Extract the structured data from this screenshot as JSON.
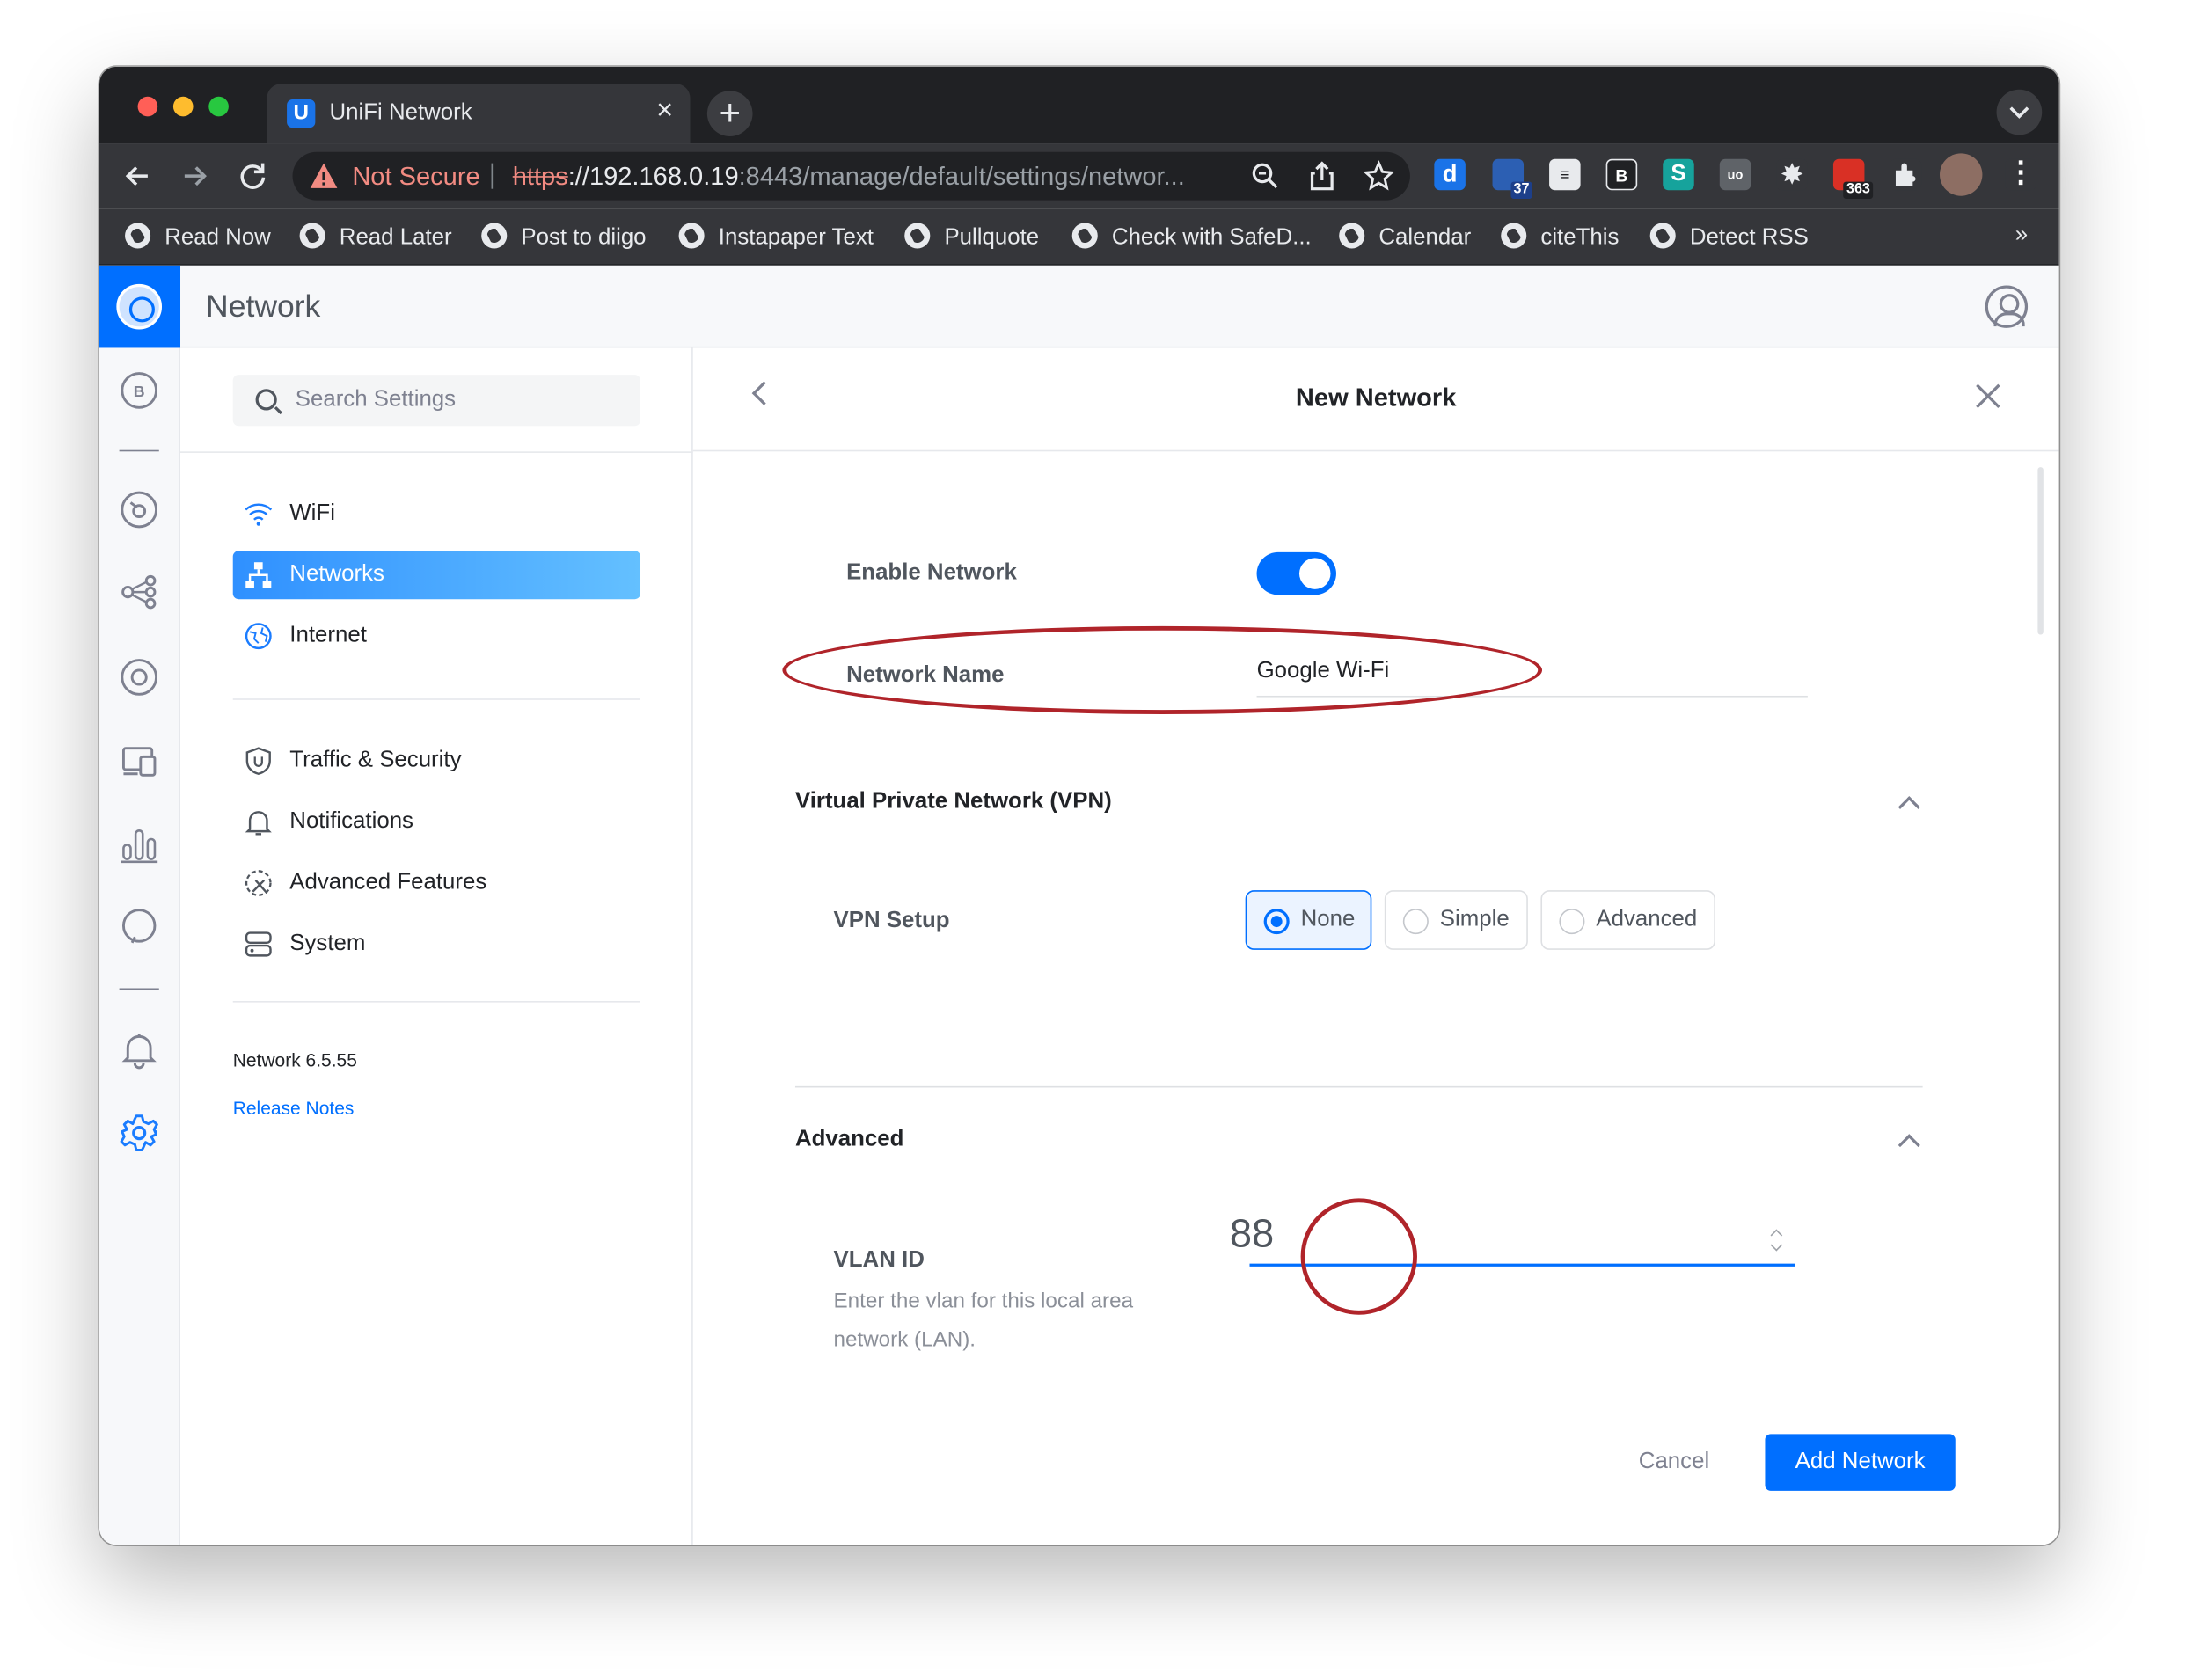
{
  "browser": {
    "tab_title": "UniFi Network",
    "tab_favicon": "U",
    "security_label": "Not Secure",
    "url_scheme": "https",
    "url_host": "://192.168.0.19",
    "url_rest": ":8443/manage/default/settings/networ...",
    "extensions": [
      {
        "name": "diigo-icon",
        "label": "d",
        "color": "#1a73e8"
      },
      {
        "name": "ext-badge-37",
        "badge": "37",
        "color": "#2c5fb3"
      },
      {
        "name": "citethis-icon",
        "label": "≡",
        "color": "#e8eaed"
      },
      {
        "name": "bookmark-b-icon",
        "label": "B",
        "color": "#202124"
      },
      {
        "name": "safari-s-icon",
        "label": "S",
        "color": "#16a39c"
      },
      {
        "name": "ublock-icon",
        "label": "uo",
        "color": "#5f6368"
      },
      {
        "name": "gear-ext-icon",
        "label": "✸",
        "color": "#5f6368"
      },
      {
        "name": "ext-badge-363",
        "badge": "363",
        "color": "#d93025"
      }
    ],
    "bookmarks": [
      "Read Now",
      "Read Later",
      "Post to diigo",
      "Instapaper Text",
      "Pullquote",
      "Check with SafeD...",
      "Calendar",
      "citeThis",
      "Detect RSS"
    ],
    "bookmarks_more": "»"
  },
  "app": {
    "title": "Network"
  },
  "settings_nav": {
    "search_placeholder": "Search Settings",
    "items": [
      {
        "label": "WiFi",
        "icon": "wifi-icon"
      },
      {
        "label": "Networks",
        "icon": "network-icon",
        "active": true
      },
      {
        "label": "Internet",
        "icon": "globe-icon"
      },
      {
        "label": "Traffic & Security",
        "icon": "shield-icon"
      },
      {
        "label": "Notifications",
        "icon": "bell-icon"
      },
      {
        "label": "Advanced Features",
        "icon": "advanced-features-icon"
      },
      {
        "label": "System",
        "icon": "system-icon"
      }
    ],
    "version": "Network 6.5.55",
    "release_notes": "Release Notes"
  },
  "form": {
    "title": "New Network",
    "enable_label": "Enable Network",
    "enable_on": true,
    "name_label": "Network Name",
    "name_value": "Google Wi-Fi",
    "vpn_section": "Virtual Private Network (VPN)",
    "vpn_setup_label": "VPN Setup",
    "vpn_options": [
      "None",
      "Simple",
      "Advanced"
    ],
    "vpn_selected": "None",
    "advanced_section": "Advanced",
    "vlan_label": "VLAN ID",
    "vlan_help": "Enter the vlan for this local area network (LAN).",
    "vlan_value": "88",
    "cancel_label": "Cancel",
    "submit_label": "Add Network"
  },
  "colors": {
    "accent": "#006fff",
    "annotation": "#b0242a"
  }
}
